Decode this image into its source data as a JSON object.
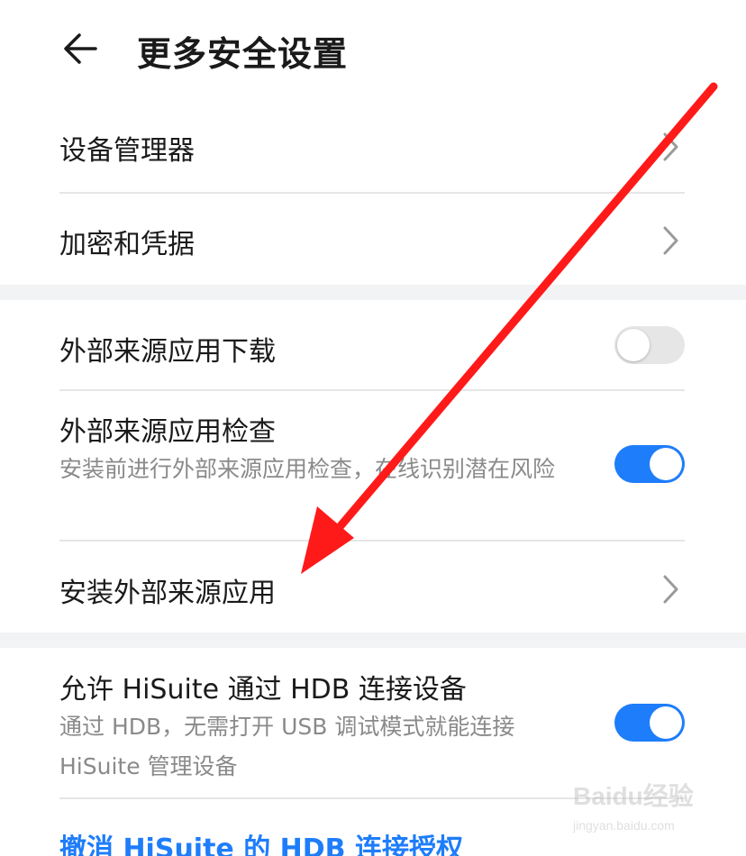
{
  "header": {
    "title": "更多安全设置"
  },
  "group1": {
    "items": [
      {
        "label": "设备管理器"
      },
      {
        "label": "加密和凭据"
      }
    ]
  },
  "group2": {
    "items": [
      {
        "label": "外部来源应用下载",
        "toggle": "off"
      },
      {
        "label": "外部来源应用检查",
        "description": "安装前进行外部来源应用检查，在线识别潜在风险",
        "toggle": "on"
      },
      {
        "label": "安装外部来源应用"
      }
    ]
  },
  "group3": {
    "items": [
      {
        "label": "允许 HiSuite 通过 HDB 连接设备",
        "description": "通过 HDB，无需打开 USB 调试模式就能连接 HiSuite 管理设备",
        "toggle": "on"
      }
    ],
    "link": "撤消 HiSuite 的 HDB 连接授权"
  },
  "watermark": {
    "brand": "Baidu经验",
    "url": "jingyan.baidu.com"
  },
  "colors": {
    "accent": "#1e7dfa",
    "annotation_arrow": "#ff1a1a",
    "section_gap": "#f1f3f5"
  },
  "icons": {
    "back": "arrow-left-icon",
    "chevron": "chevron-right-icon"
  }
}
